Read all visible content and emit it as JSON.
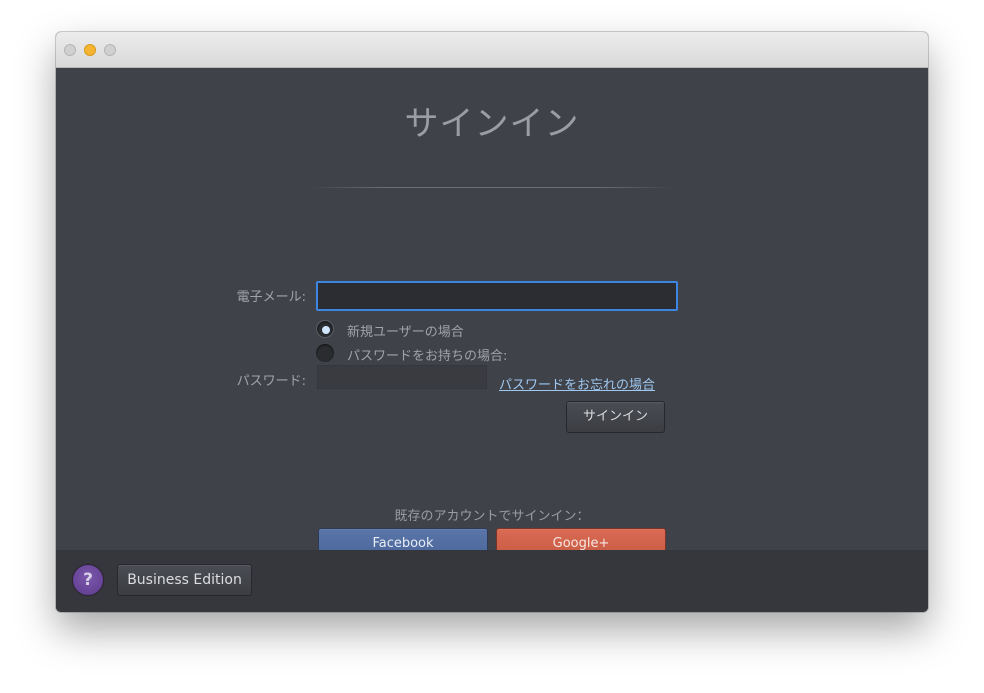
{
  "window": {
    "title_bar_buttons": [
      "close",
      "minimize",
      "maximize"
    ]
  },
  "page": {
    "title": "サインイン"
  },
  "form": {
    "email_label": "電子メール:",
    "email_value": "",
    "radio_new_user": "新規ユーザーの場合",
    "radio_existing_password": "パスワードをお持ちの場合:",
    "radio_selected": "new_user",
    "password_label": "パスワード:",
    "password_value": "",
    "forgot_password_link": "パスワードをお忘れの場合",
    "signin_button": "サインイン"
  },
  "social": {
    "label": "既存のアカウントでサインイン：",
    "facebook_button": "Facebook",
    "google_button": "Google+"
  },
  "footer": {
    "help_button": "?",
    "business_button": "Business Edition"
  },
  "colors": {
    "background": "#3f4249",
    "footer": "#35373c",
    "accent_focus": "#3b86e0",
    "facebook": "#4f6aa0",
    "google": "#cf614b",
    "help": "#6a479b"
  }
}
